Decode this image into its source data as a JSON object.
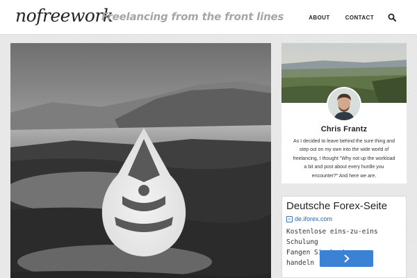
{
  "header": {
    "logo": "nofreework",
    "tagline": "Freelancing from the front lines",
    "nav": [
      "ABOUT",
      "CONTACT"
    ],
    "search_icon": "search-icon"
  },
  "hero": {
    "image": "grayscale lake and forest landscape with white drop-shaped emblem",
    "emblem_icon": "drop-emblem-icon"
  },
  "profile": {
    "name": "Chris Frantz",
    "bio_lines": [
      "As I decided to leave behind the sure thing and",
      "step out on my own into the wide world of",
      "freelancing, I thought \"Why not up the workload",
      "a bit and post about every hurdle you",
      "encounter?\" And here we are."
    ]
  },
  "ad": {
    "title": "Deutsche Forex-Seite",
    "url": "de.iforex.com",
    "desc_lines": [
      "Kostenlose eins-zu-eins Schulung",
      "Fangen Sie heute an zu handeln"
    ],
    "button_icon": "chevron-right-icon",
    "button_color": "#3b82d6"
  }
}
